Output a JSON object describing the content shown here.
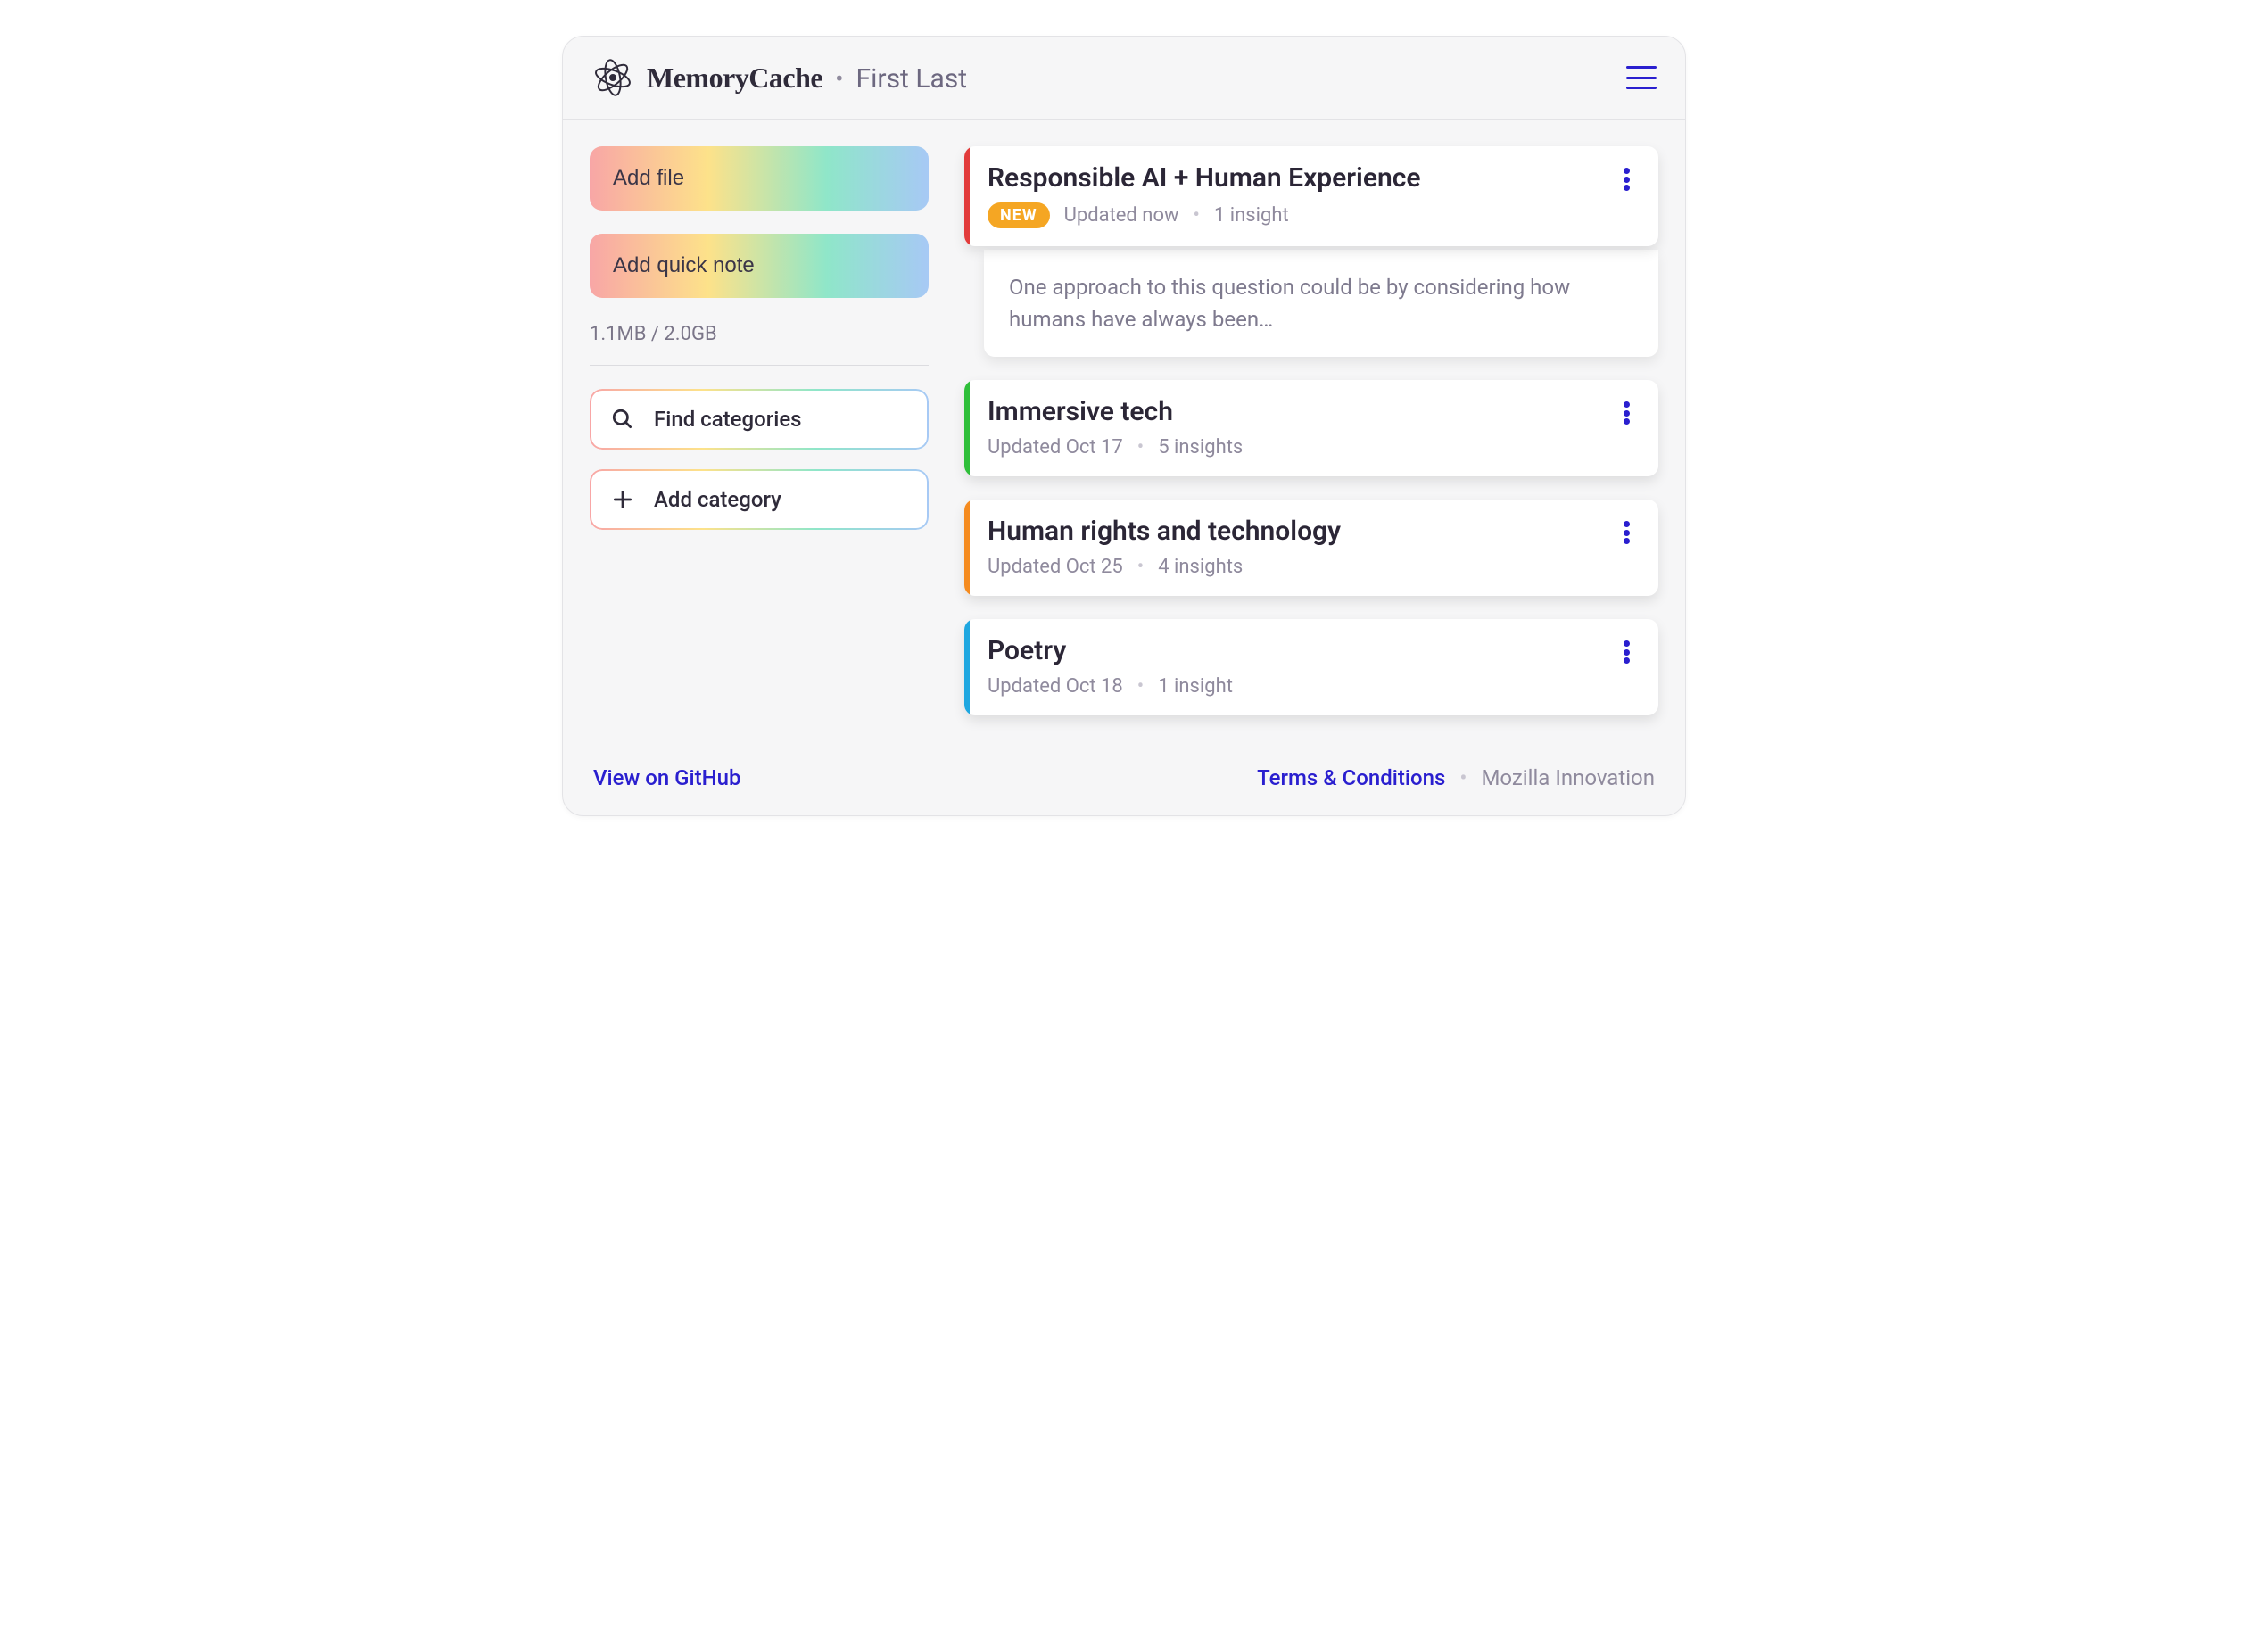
{
  "header": {
    "app_title": "MemoryCache",
    "user_name": "First Last"
  },
  "sidebar": {
    "add_file_label": "Add file",
    "add_note_label": "Add quick note",
    "storage_text": "1.1MB / 2.0GB",
    "find_categories_label": "Find categories",
    "add_category_label": "Add category"
  },
  "cards": [
    {
      "title": "Responsible AI + Human Experience",
      "badge": "NEW",
      "updated": "Updated now",
      "insights": "1 insight",
      "stripe_color": "#e23b3b",
      "note": "One approach to this question could be by considering how humans have always been…"
    },
    {
      "title": "Immersive tech",
      "updated": "Updated Oct 17",
      "insights": "5 insights",
      "stripe_color": "#2fbf3a"
    },
    {
      "title": "Human rights and technology",
      "updated": "Updated Oct 25",
      "insights": "4 insights",
      "stripe_color": "#f58b1f"
    },
    {
      "title": "Poetry",
      "updated": "Updated Oct 18",
      "insights": "1 insight",
      "stripe_color": "#1fa7e0"
    }
  ],
  "footer": {
    "github_label": "View on GitHub",
    "terms_label": "Terms & Conditions",
    "org_label": "Mozilla Innovation"
  }
}
